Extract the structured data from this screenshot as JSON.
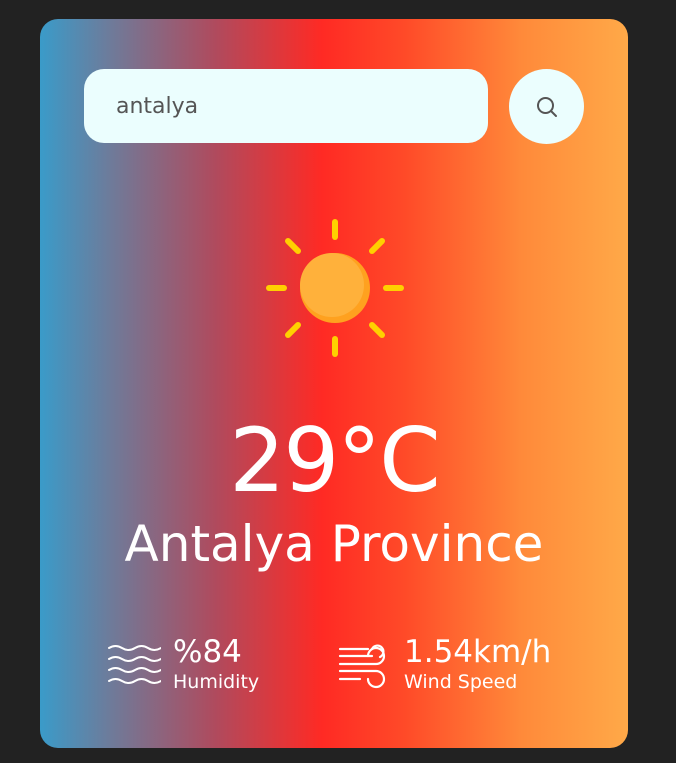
{
  "search": {
    "value": "antalya",
    "button_icon": "search-icon"
  },
  "weather": {
    "icon": "sun-icon",
    "temperature": "29°C",
    "city": "Antalya Province"
  },
  "details": {
    "humidity": {
      "value": "%84",
      "label": "Humidity",
      "icon": "waves-icon"
    },
    "wind": {
      "value": "1.54km/h",
      "label": "Wind Speed",
      "icon": "wind-icon"
    }
  },
  "colors": {
    "background": "#222222",
    "input": "#ebfefe",
    "sun": "#ffb13b",
    "sun_rays": "#ffd000",
    "text": "#ffffff"
  }
}
